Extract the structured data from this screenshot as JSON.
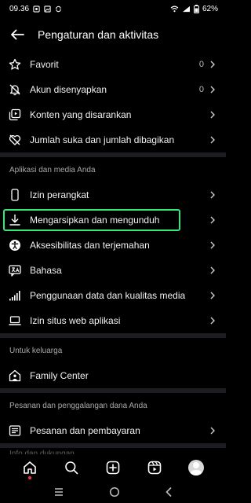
{
  "status_bar": {
    "time": "09.36",
    "battery": "62%"
  },
  "header": {
    "title": "Pengaturan dan aktivitas"
  },
  "group1": [
    {
      "label": "Favorit",
      "count": "0"
    },
    {
      "label": "Akun disenyapkan",
      "count": "0"
    },
    {
      "label": "Konten yang disarankan"
    },
    {
      "label": "Jumlah suka dan jumlah dibagikan"
    }
  ],
  "apps_section": {
    "title": "Aplikasi dan media Anda",
    "items": [
      {
        "label": "Izin perangkat"
      },
      {
        "label": "Mengarsipkan dan mengunduh"
      },
      {
        "label": "Aksesibilitas dan terjemahan"
      },
      {
        "label": "Bahasa"
      },
      {
        "label": "Penggunaan data dan kualitas media"
      },
      {
        "label": "Izin situs web aplikasi"
      }
    ]
  },
  "family_section": {
    "title": "Untuk keluarga",
    "items": [
      {
        "label": "Family Center"
      }
    ]
  },
  "orders_section": {
    "title": "Pesanan dan penggalangan dana Anda",
    "items": [
      {
        "label": "Pesanan dan pembayaran"
      }
    ]
  },
  "partial_section": {
    "title": "Info dan dukungan"
  },
  "highlight_color": "#35e87a",
  "bottom_nav": [
    "home-icon",
    "search-icon",
    "create-icon",
    "reels-icon",
    "profile-avatar"
  ],
  "system_nav": [
    "recents-icon",
    "home-circle-icon",
    "back-icon"
  ]
}
